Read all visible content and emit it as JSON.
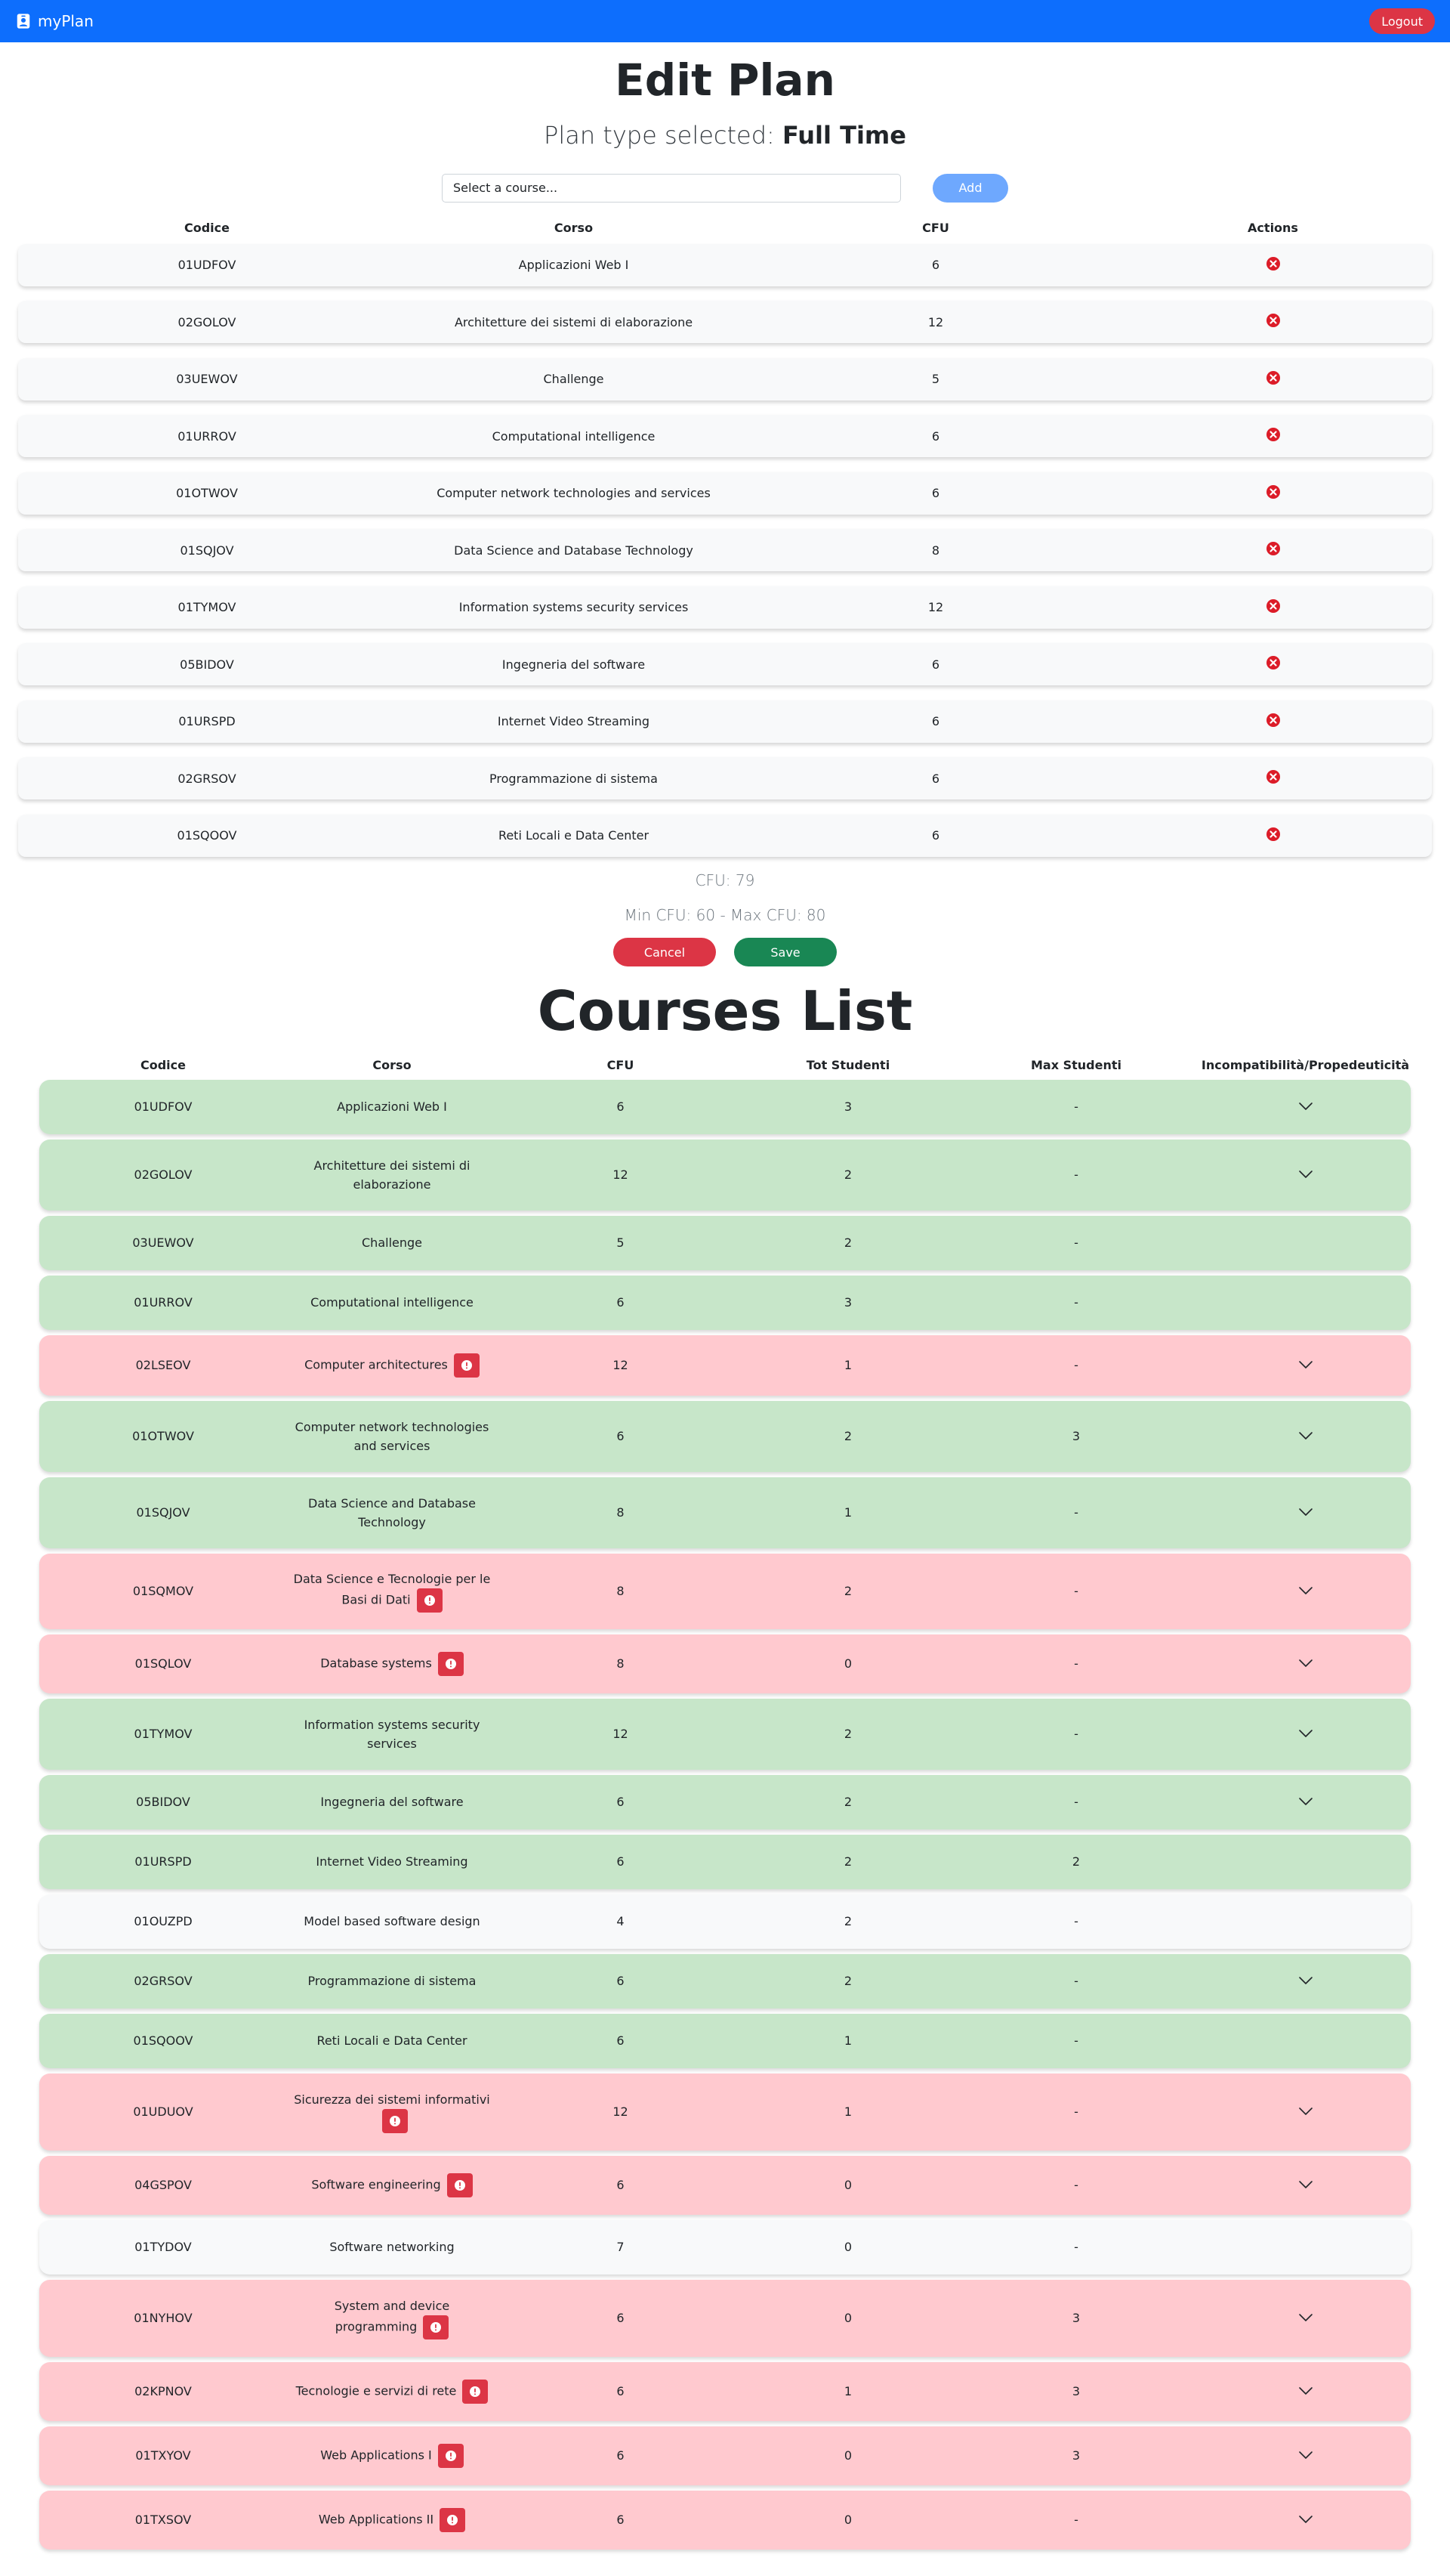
{
  "navbar": {
    "brand": "myPlan",
    "logout_label": "Logout"
  },
  "edit_plan": {
    "title": "Edit Plan",
    "plan_type_prefix": "Plan type selected:",
    "plan_type": "Full Time",
    "select_placeholder": "Select a course...",
    "add_label": "Add",
    "headers": [
      "Codice",
      "Corso",
      "CFU",
      "Actions"
    ],
    "rows": [
      {
        "code": "01UDFOV",
        "name": "Applicazioni Web I",
        "cfu": "6"
      },
      {
        "code": "02GOLOV",
        "name": "Architetture dei sistemi di elaborazione",
        "cfu": "12"
      },
      {
        "code": "03UEWOV",
        "name": "Challenge",
        "cfu": "5"
      },
      {
        "code": "01URROV",
        "name": "Computational intelligence",
        "cfu": "6"
      },
      {
        "code": "01OTWOV",
        "name": "Computer network technologies and services",
        "cfu": "6"
      },
      {
        "code": "01SQJOV",
        "name": "Data Science and Database Technology",
        "cfu": "8"
      },
      {
        "code": "01TYMOV",
        "name": "Information systems security services",
        "cfu": "12"
      },
      {
        "code": "05BIDOV",
        "name": "Ingegneria del software",
        "cfu": "6"
      },
      {
        "code": "01URSPD",
        "name": "Internet Video Streaming",
        "cfu": "6"
      },
      {
        "code": "02GRSOV",
        "name": "Programmazione di sistema",
        "cfu": "6"
      },
      {
        "code": "01SQOOV",
        "name": "Reti Locali e Data Center",
        "cfu": "6"
      }
    ],
    "cfu_total": "CFU: 79",
    "cfu_range": "Min CFU: 60 - Max CFU: 80",
    "cancel_label": "Cancel",
    "save_label": "Save"
  },
  "courses_list": {
    "title": "Courses List",
    "headers": [
      "Codice",
      "Corso",
      "CFU",
      "Tot Studenti",
      "Max Studenti",
      "Incompatibilità/Propedeuticità"
    ],
    "rows": [
      {
        "code": "01UDFOV",
        "name": "Applicazioni Web I",
        "cfu": "6",
        "tot": "3",
        "max": "-",
        "status": "ok",
        "warn": false,
        "expand": true,
        "h": 72
      },
      {
        "code": "02GOLOV",
        "name": "Architetture dei sistemi di elaborazione",
        "cfu": "12",
        "tot": "2",
        "max": "-",
        "status": "ok",
        "warn": false,
        "expand": true,
        "h": 94
      },
      {
        "code": "03UEWOV",
        "name": "Challenge",
        "cfu": "5",
        "tot": "2",
        "max": "-",
        "status": "ok",
        "warn": false,
        "expand": false,
        "h": 72
      },
      {
        "code": "01URROV",
        "name": "Computational intelligence",
        "cfu": "6",
        "tot": "3",
        "max": "-",
        "status": "ok",
        "warn": false,
        "expand": false,
        "h": 72
      },
      {
        "code": "02LSEOV",
        "name": "Computer architectures",
        "cfu": "12",
        "tot": "1",
        "max": "-",
        "status": "bad",
        "warn": true,
        "expand": true,
        "h": 80
      },
      {
        "code": "01OTWOV",
        "name": "Computer network technologies and services",
        "cfu": "6",
        "tot": "2",
        "max": "3",
        "status": "ok",
        "warn": false,
        "expand": true,
        "h": 94
      },
      {
        "code": "01SQJOV",
        "name": "Data Science and Database Technology",
        "cfu": "8",
        "tot": "1",
        "max": "-",
        "status": "ok",
        "warn": false,
        "expand": true,
        "h": 94
      },
      {
        "code": "01SQMOV",
        "name": "Data Science e Tecnologie per le Basi di Dati",
        "cfu": "8",
        "tot": "2",
        "max": "-",
        "status": "bad",
        "warn": true,
        "expand": true,
        "h": 100
      },
      {
        "code": "01SQLOV",
        "name": "Database systems",
        "cfu": "8",
        "tot": "0",
        "max": "-",
        "status": "bad",
        "warn": true,
        "expand": true,
        "h": 78
      },
      {
        "code": "01TYMOV",
        "name": "Information systems security services",
        "cfu": "12",
        "tot": "2",
        "max": "-",
        "status": "ok",
        "warn": false,
        "expand": true,
        "h": 94
      },
      {
        "code": "05BIDOV",
        "name": "Ingegneria del software",
        "cfu": "6",
        "tot": "2",
        "max": "-",
        "status": "ok",
        "warn": false,
        "expand": true,
        "h": 72
      },
      {
        "code": "01URSPD",
        "name": "Internet Video Streaming",
        "cfu": "6",
        "tot": "2",
        "max": "2",
        "status": "ok",
        "warn": false,
        "expand": false,
        "h": 72
      },
      {
        "code": "01OUZPD",
        "name": "Model based software design",
        "cfu": "4",
        "tot": "2",
        "max": "-",
        "status": "neutral",
        "warn": false,
        "expand": false,
        "h": 72
      },
      {
        "code": "02GRSOV",
        "name": "Programmazione di sistema",
        "cfu": "6",
        "tot": "2",
        "max": "-",
        "status": "ok",
        "warn": false,
        "expand": true,
        "h": 72
      },
      {
        "code": "01SQOOV",
        "name": "Reti Locali e Data Center",
        "cfu": "6",
        "tot": "1",
        "max": "-",
        "status": "ok",
        "warn": false,
        "expand": false,
        "h": 72
      },
      {
        "code": "01UDUOV",
        "name": "Sicurezza dei sistemi informativi",
        "cfu": "12",
        "tot": "1",
        "max": "-",
        "status": "bad",
        "warn": true,
        "expand": true,
        "h": 102
      },
      {
        "code": "04GSPOV",
        "name": "Software engineering",
        "cfu": "6",
        "tot": "0",
        "max": "-",
        "status": "bad",
        "warn": true,
        "expand": true,
        "h": 78
      },
      {
        "code": "01TYDOV",
        "name": "Software networking",
        "cfu": "7",
        "tot": "0",
        "max": "-",
        "status": "neutral",
        "warn": false,
        "expand": false,
        "h": 72
      },
      {
        "code": "01NYHOV",
        "name": "System and device programming",
        "cfu": "6",
        "tot": "0",
        "max": "3",
        "status": "bad",
        "warn": true,
        "expand": true,
        "h": 102
      },
      {
        "code": "02KPNOV",
        "name": "Tecnologie e servizi di rete",
        "cfu": "6",
        "tot": "1",
        "max": "3",
        "status": "bad",
        "warn": true,
        "expand": true,
        "h": 78
      },
      {
        "code": "01TXYOV",
        "name": "Web Applications I",
        "cfu": "6",
        "tot": "0",
        "max": "3",
        "status": "bad",
        "warn": true,
        "expand": true,
        "h": 78
      },
      {
        "code": "01TXSOV",
        "name": "Web Applications II",
        "cfu": "6",
        "tot": "0",
        "max": "-",
        "status": "bad",
        "warn": true,
        "expand": true,
        "h": 78
      }
    ]
  },
  "icons": {
    "brand": "person-badge-icon",
    "remove": "x-circle-icon",
    "warning": "exclamation-circle-icon",
    "expand": "chevron-down-icon"
  },
  "colors": {
    "primary": "#0d6efd",
    "danger": "#dc3545",
    "success": "#198754",
    "row_ok": "#c7e6c9",
    "row_bad": "#ffc9cf",
    "row_neutral": "#f8f9fa"
  }
}
